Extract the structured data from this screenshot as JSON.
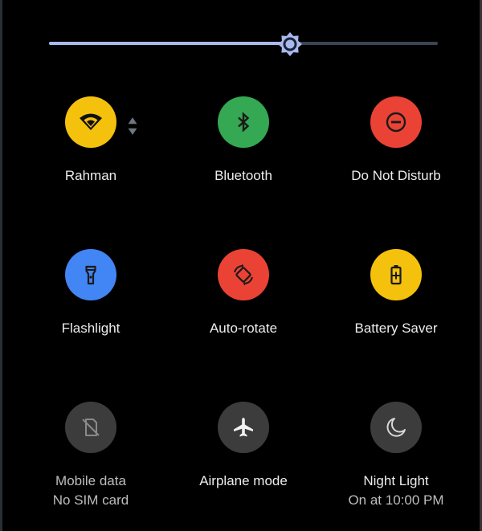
{
  "brightness": {
    "level": 0.62,
    "track_color": "#3c4452",
    "fill_color": "#a9b9ee",
    "thumb_icon": "brightness-sun-icon"
  },
  "tiles": [
    {
      "id": "wifi",
      "label": "Rahman",
      "sub": "",
      "icon": "wifi-icon",
      "color": "#f4c20d",
      "state": "on",
      "extra_icon": "signal-arrows-icon"
    },
    {
      "id": "bluetooth",
      "label": "Bluetooth",
      "sub": "",
      "icon": "bluetooth-icon",
      "color": "#34a853",
      "state": "on"
    },
    {
      "id": "dnd",
      "label": "Do Not Disturb",
      "sub": "",
      "icon": "do-not-disturb-icon",
      "color": "#ea4335",
      "state": "on"
    },
    {
      "id": "flashlight",
      "label": "Flashlight",
      "sub": "",
      "icon": "flashlight-icon",
      "color": "#4285f4",
      "state": "on"
    },
    {
      "id": "autorotate",
      "label": "Auto-rotate",
      "sub": "",
      "icon": "auto-rotate-icon",
      "color": "#ea4335",
      "state": "on"
    },
    {
      "id": "battery",
      "label": "Battery Saver",
      "sub": "",
      "icon": "battery-saver-icon",
      "color": "#f4c20d",
      "state": "on"
    },
    {
      "id": "mobiledata",
      "label": "Mobile data",
      "sub": "No SIM card",
      "icon": "no-sim-icon",
      "color": "#3c3c3c",
      "state": "disabled"
    },
    {
      "id": "airplane",
      "label": "Airplane mode",
      "sub": "",
      "icon": "airplane-icon",
      "color": "#3c3c3c",
      "state": "off"
    },
    {
      "id": "nightlight",
      "label": "Night Light",
      "sub": "On at 10:00 PM",
      "icon": "night-light-icon",
      "color": "#3c3c3c",
      "state": "off"
    }
  ]
}
